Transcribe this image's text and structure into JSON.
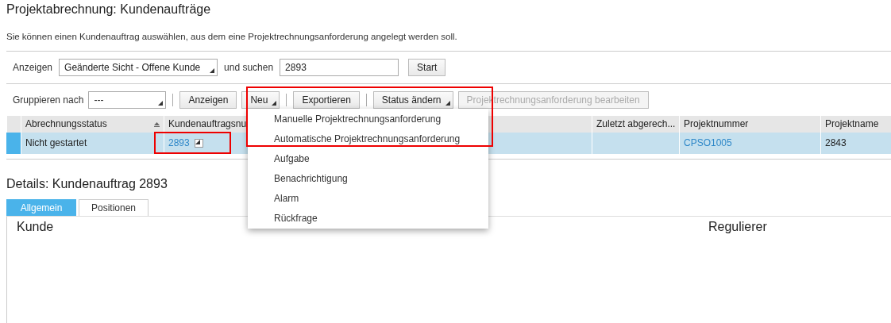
{
  "page": {
    "title": "Projektabrechnung: Kundenaufträge",
    "hint": "Sie können einen Kundenauftrag auswählen, aus dem eine Projektrechnungsanforderung angelegt werden soll."
  },
  "filter": {
    "view_label": "Anzeigen",
    "view_value": "Geänderte Sicht - Offene Kunde",
    "search_label": "und suchen",
    "search_value": "2893",
    "start_button": "Start"
  },
  "toolbar": {
    "group_label": "Gruppieren nach",
    "group_value": "---",
    "buttons": [
      {
        "label": "Anzeigen",
        "kind": "plain",
        "disabled": false
      },
      {
        "label": "Neu",
        "kind": "menu",
        "disabled": false
      },
      {
        "label": "Exportieren",
        "kind": "plain",
        "disabled": false
      },
      {
        "label": "Status ändern",
        "kind": "menu",
        "disabled": false
      },
      {
        "label": "Projektrechnungsanforderung bearbeiten",
        "kind": "plain",
        "disabled": true
      }
    ]
  },
  "table": {
    "columns": [
      {
        "label": "Abrechnungsstatus",
        "sortable": true
      },
      {
        "label": "Kundenauftragsnu",
        "sortable": false
      },
      {
        "sortable": false
      },
      {
        "label": "Zuletzt abgerech...",
        "sortable": false
      },
      {
        "label": "Projektnummer",
        "sortable": false
      },
      {
        "label": "Projektname",
        "sortable": false
      }
    ],
    "rows": [
      {
        "selected": true,
        "cells": [
          {
            "text": "Nicht gestartet",
            "kind": "text"
          },
          {
            "text": "2893",
            "kind": "menu-link"
          },
          {
            "kind": "empty"
          },
          {
            "kind": "empty"
          },
          {
            "text": "CPSO1005",
            "kind": "link"
          },
          {
            "text": "2843",
            "kind": "text"
          }
        ]
      }
    ]
  },
  "menu": {
    "items": [
      "Manuelle Projektrechnungsanforderung",
      "Automatische Projektrechnungsanforderung",
      "Aufgabe",
      "Benachrichtigung",
      "Alarm",
      "Rückfrage"
    ]
  },
  "details": {
    "title": "Details: Kundenauftrag 2893",
    "tabs": [
      {
        "label": "Allgemein",
        "selected": true
      },
      {
        "label": "Positionen",
        "selected": false
      }
    ],
    "fields": [
      "Kunde",
      "Regulierer"
    ]
  }
}
